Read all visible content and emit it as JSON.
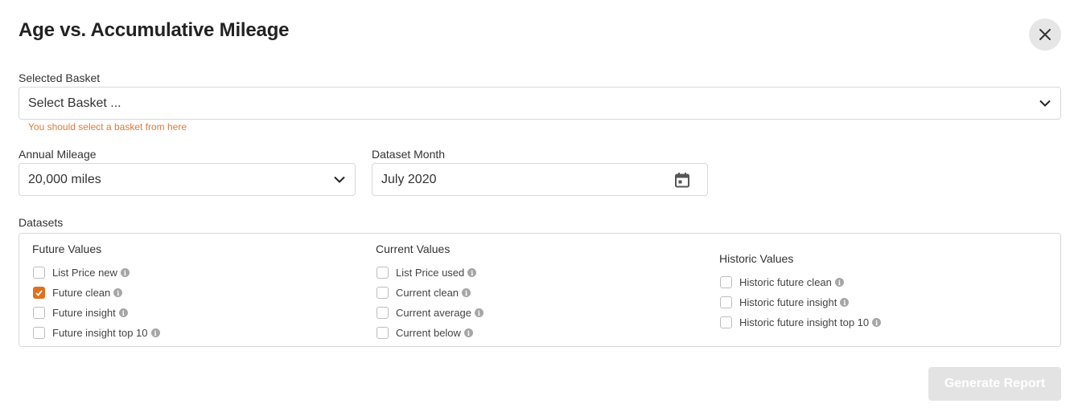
{
  "dialog": {
    "title": "Age vs. Accumulative Mileage",
    "close_icon": "close-icon"
  },
  "basket": {
    "label": "Selected Basket",
    "value": "Select Basket ...",
    "hint": "You should select a basket from here"
  },
  "mileage": {
    "label": "Annual Mileage",
    "value": "20,000 miles"
  },
  "dataset_month": {
    "label": "Dataset Month",
    "value": "July 2020"
  },
  "datasets": {
    "label": "Datasets",
    "future": {
      "title": "Future Values",
      "items": [
        {
          "label": "List Price new",
          "checked": false
        },
        {
          "label": "Future clean",
          "checked": true
        },
        {
          "label": "Future insight",
          "checked": false
        },
        {
          "label": "Future insight top 10",
          "checked": false
        }
      ]
    },
    "current": {
      "title": "Current Values",
      "items": [
        {
          "label": "List Price used",
          "checked": false
        },
        {
          "label": "Current clean",
          "checked": false
        },
        {
          "label": "Current average",
          "checked": false
        },
        {
          "label": "Current below",
          "checked": false
        }
      ]
    },
    "historic": {
      "title": "Historic Values",
      "items": [
        {
          "label": "Historic future clean",
          "checked": false
        },
        {
          "label": "Historic future insight",
          "checked": false
        },
        {
          "label": "Historic future insight top 10",
          "checked": false
        }
      ]
    }
  },
  "actions": {
    "generate_label": "Generate Report"
  },
  "colors": {
    "accent": "#e0701e",
    "hint": "#e07a3a",
    "disabled_button": "#e3e3e3"
  }
}
